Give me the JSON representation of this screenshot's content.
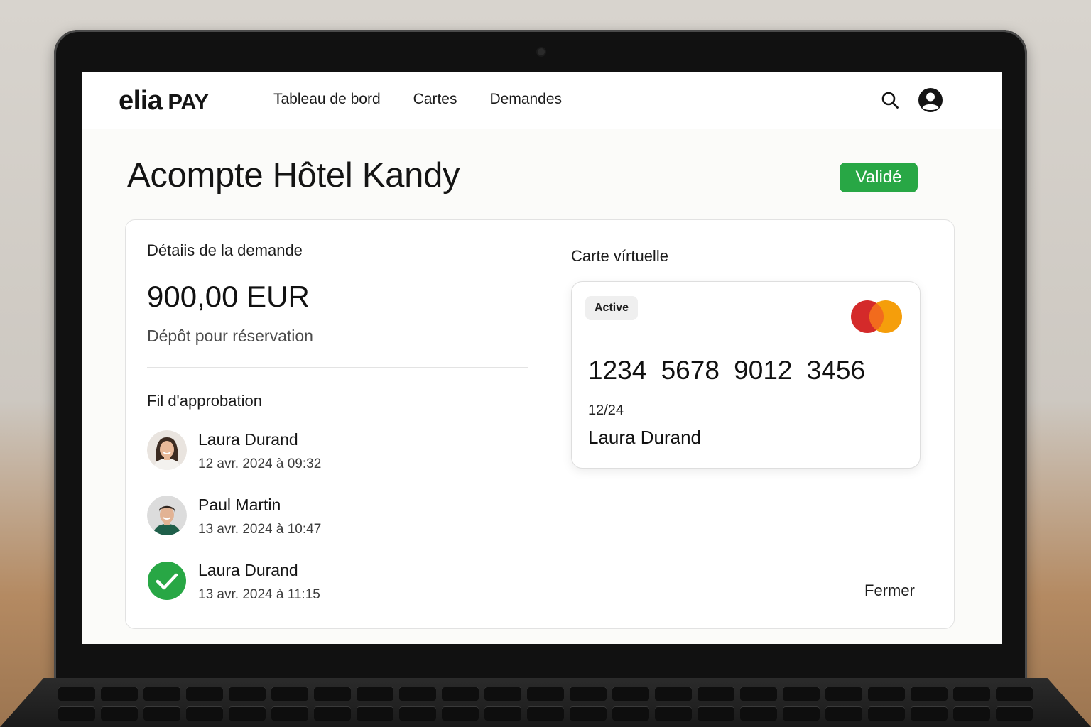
{
  "app": {
    "logo_main": "elia",
    "logo_sub": "PAY",
    "nav": [
      {
        "label": "Tableau de bord"
      },
      {
        "label": "Cartes"
      },
      {
        "label": "Demandes"
      }
    ],
    "search_icon": "search-icon",
    "profile_icon": "user-circle-icon"
  },
  "page": {
    "title": "Acompte Hôtel Kandy",
    "status": "Validé",
    "status_color": "#28a745"
  },
  "details": {
    "heading": "Détaiis de la demande",
    "amount": "900,00 EUR",
    "description": "Dépôt pour réservation"
  },
  "approval": {
    "heading": "Fil d'approbation",
    "items": [
      {
        "name": "Laura Durand",
        "date": "12 avr. 2024 à 09:32",
        "icon": "avatar"
      },
      {
        "name": "Paul Martin",
        "date": "13 avr. 2024 à 10:47",
        "icon": "avatar"
      },
      {
        "name": "Laura Durand",
        "date": "13 avr. 2024 à 11:15",
        "icon": "check-circle-icon"
      }
    ]
  },
  "virtual_card": {
    "heading": "Carte vírtuelle",
    "state": "Active",
    "number": "1234  5678  9012  3456",
    "expiry": "12/24",
    "holder": "Laura Durand",
    "brand_icon": "mastercard-logo",
    "brand_colors": [
      "#d42a2a",
      "#f59e0b"
    ]
  },
  "actions": {
    "close_label": "Fermer"
  }
}
